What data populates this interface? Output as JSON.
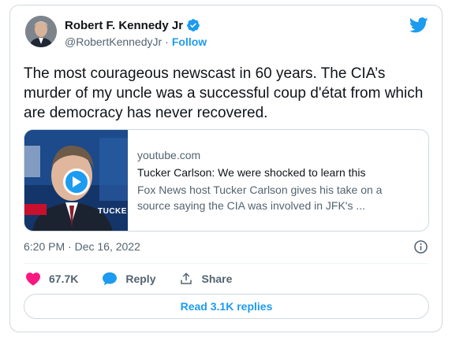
{
  "author": {
    "name": "Robert F. Kennedy Jr",
    "handle": "@RobertKennedyJr",
    "separator": "·",
    "follow_label": "Follow"
  },
  "tweet": {
    "text": "The most courageous newscast in 60 years. The CIA’s murder of my uncle was a successful coup d'état from which are democracy has never recovered."
  },
  "link_card": {
    "domain": "youtube.com",
    "title": "Tucker Carlson: We were shocked to learn this",
    "description": "Fox News host Tucker Carlson gives his take on a source saying the CIA was involved in JFK's ...",
    "thumbnail_text": "TUCKE"
  },
  "timestamp": "6:20 PM · Dec 16, 2022",
  "actions": {
    "likes": "67.7K",
    "reply_label": "Reply",
    "share_label": "Share"
  },
  "replies_button": "Read 3.1K replies",
  "colors": {
    "accent": "#1d9bf0",
    "like": "#f91880",
    "text_secondary": "#536471",
    "border": "#cfd9de"
  },
  "icons": [
    "verified-badge-icon",
    "twitter-bird-icon",
    "play-icon",
    "info-icon",
    "heart-icon",
    "reply-bubble-icon",
    "share-icon"
  ]
}
